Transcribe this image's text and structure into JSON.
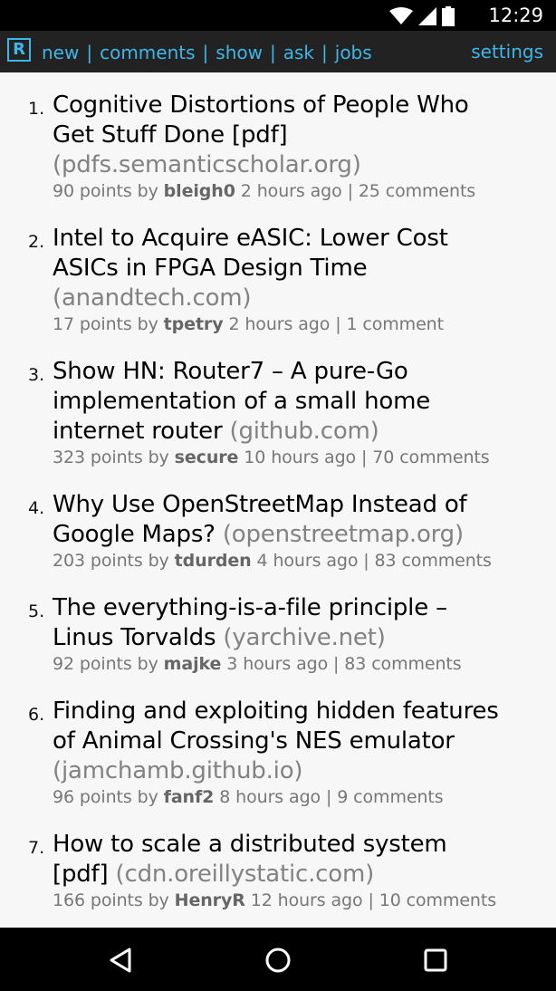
{
  "status_bar": {
    "time": "12:29"
  },
  "header": {
    "logo": "R",
    "nav_items": [
      "new",
      "comments",
      "show",
      "ask",
      "jobs"
    ],
    "settings": "settings"
  },
  "stories": [
    {
      "rank": "1.",
      "title_lines": [
        "Cognitive Distortions of People Who",
        "Get Stuff Done [pdf]"
      ],
      "domain": "(pdfs.semanticscholar.org)",
      "domain_inline": false,
      "points": "90 points by",
      "user": "bleigh0",
      "age": "2 hours ago",
      "comments": "25 comments"
    },
    {
      "rank": "2.",
      "title_lines": [
        "Intel to Acquire eASIC: Lower Cost",
        "ASICs in FPGA Design Time"
      ],
      "domain": "(anandtech.com)",
      "domain_inline": false,
      "points": "17 points by",
      "user": "tpetry",
      "age": "2 hours ago",
      "comments": "1 comment"
    },
    {
      "rank": "3.",
      "title_lines": [
        "Show HN: Router7 – A pure-Go",
        "implementation of a small home",
        "internet router"
      ],
      "domain": "(github.com)",
      "domain_inline": true,
      "points": "323 points by",
      "user": "secure",
      "age": "10 hours ago",
      "comments": "70 comments"
    },
    {
      "rank": "4.",
      "title_lines": [
        "Why Use OpenStreetMap Instead of",
        "Google Maps?"
      ],
      "domain": "(openstreetmap.org)",
      "domain_inline": true,
      "points": "203 points by",
      "user": "tdurden",
      "age": "4 hours ago",
      "comments": "83 comments"
    },
    {
      "rank": "5.",
      "title_lines": [
        "The everything-is-a-file principle –",
        "Linus Torvalds"
      ],
      "domain": "(yarchive.net)",
      "domain_inline": true,
      "points": "92 points by",
      "user": "majke",
      "age": "3 hours ago",
      "comments": "83 comments"
    },
    {
      "rank": "6.",
      "title_lines": [
        "Finding and exploiting hidden features",
        "of Animal Crossing's NES emulator"
      ],
      "domain": "(jamchamb.github.io)",
      "domain_inline": false,
      "points": "96 points by",
      "user": "fanf2",
      "age": "8 hours ago",
      "comments": "9 comments"
    },
    {
      "rank": "7.",
      "title_lines": [
        "How to scale a distributed system",
        "[pdf]"
      ],
      "domain": "(cdn.oreillystatic.com)",
      "domain_inline": true,
      "points": "166 points by",
      "user": "HenryR",
      "age": "12 hours ago",
      "comments": "10 comments"
    }
  ],
  "icons": {
    "back": "back-triangle-icon",
    "home": "home-circle-icon",
    "recents": "recents-square-icon"
  },
  "colors": {
    "accent": "#3fb6e8",
    "header_bg": "#222222",
    "content_bg": "#f7f7f7",
    "meta": "#777777",
    "domain": "#828282"
  }
}
